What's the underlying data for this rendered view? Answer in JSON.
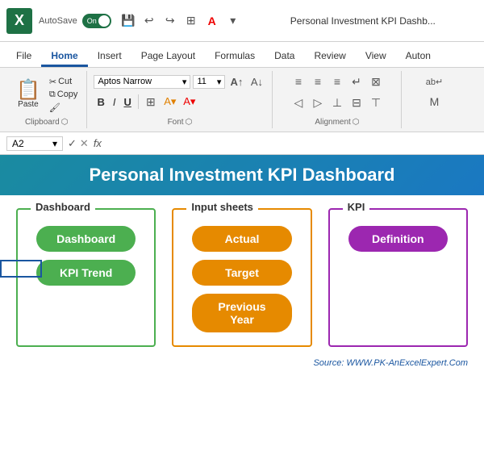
{
  "titlebar": {
    "excel_label": "X",
    "autosave_label": "AutoSave",
    "toggle_state": "On",
    "title": "Personal Investment KPI Dashb...",
    "toolbar_icons": [
      "⬜⬜",
      "↩",
      "↪",
      "⊞",
      "A",
      "▼"
    ]
  },
  "ribbon": {
    "tabs": [
      "File",
      "Home",
      "Insert",
      "Page Layout",
      "Formulas",
      "Data",
      "Review",
      "View",
      "Auton"
    ],
    "active_tab": "Home",
    "groups": {
      "clipboard": {
        "label": "Clipboard",
        "paste_label": "Paste",
        "cut_label": "Cut",
        "copy_label": "Copy",
        "format_painter_label": "Format Painter"
      },
      "font": {
        "label": "Font",
        "font_name": "Aptos Narrow",
        "font_size": "11",
        "bold": "B",
        "italic": "I",
        "underline": "U"
      },
      "alignment": {
        "label": "Alignment"
      }
    }
  },
  "formula_bar": {
    "cell_ref": "A2",
    "fx_label": "fx"
  },
  "dashboard": {
    "title": "Personal Investment KPI Dashboard",
    "sections": [
      {
        "id": "dashboard",
        "label": "Dashboard",
        "color": "green",
        "buttons": [
          "Dashboard",
          "KPI Trend"
        ]
      },
      {
        "id": "input_sheets",
        "label": "Input sheets",
        "color": "orange",
        "buttons": [
          "Actual",
          "Target",
          "Previous Year"
        ]
      },
      {
        "id": "kpi",
        "label": "KPI",
        "color": "purple",
        "buttons": [
          "Definition"
        ]
      }
    ],
    "source": "Source: WWW.PK-AnExcelExpert.Com"
  }
}
